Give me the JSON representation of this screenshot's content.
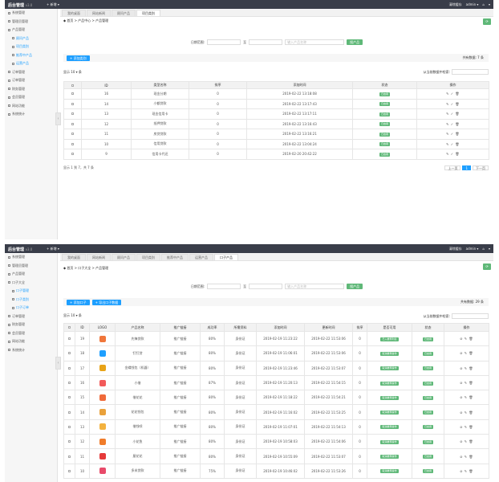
{
  "app": {
    "brand": "后台管理",
    "version": "v3.0",
    "new_menu": "+ 新增 ▾",
    "right_links": [
      "清除缓存",
      "admin ▾"
    ]
  },
  "shot1": {
    "sidebar": [
      {
        "label": "系统管理",
        "sub": false
      },
      {
        "label": "管理员管理",
        "sub": false
      },
      {
        "label": "产品管理",
        "sub": false
      },
      {
        "label": "顾问产品",
        "sub": true
      },
      {
        "label": "项目类别",
        "sub": true
      },
      {
        "label": "推荐中产品",
        "sub": true
      },
      {
        "label": "运营产品",
        "sub": true
      },
      {
        "label": "订单管理",
        "sub": false
      },
      {
        "label": "订单管理",
        "sub": false
      },
      {
        "label": "财务管理",
        "sub": false
      },
      {
        "label": "会员管理",
        "sub": false
      },
      {
        "label": "网站功能",
        "sub": false
      },
      {
        "label": "系统统计",
        "sub": false
      }
    ],
    "tabs": [
      "我的桌面",
      "网站新闻",
      "顾问产品",
      "项目类别"
    ],
    "breadcrumb": "◆ 首页 > 产品中心 > 产品管理",
    "filter": {
      "label": "日期范围:",
      "start": "",
      "sep": "至",
      "keyword_placeholder": "输入产品名称",
      "search_btn": "搜产品"
    },
    "add_btn": "+ 添加类别",
    "total": "共有数据: 7 条",
    "page_size": "显示 10 ▾ 条",
    "search_label": "从当前数据中检索:",
    "columns": [
      "",
      "ID",
      "类型名称",
      "排序",
      "添加时间",
      "状态",
      "操作"
    ],
    "rows": [
      {
        "id": "16",
        "name": "现金分期",
        "sort": "0",
        "time": "2019-02-22 13:18:08",
        "status": "已启用",
        "acts": "✎ ✓ 🗑"
      },
      {
        "id": "14",
        "name": "小额贷款",
        "sort": "0",
        "time": "2019-02-22 13:17:43",
        "status": "已启用",
        "acts": "✎ ✓ 🗑"
      },
      {
        "id": "13",
        "name": "现金信用卡",
        "sort": "0",
        "time": "2019-02-22 13:17:11",
        "status": "已启用",
        "acts": "✎ ✓ 🗑"
      },
      {
        "id": "12",
        "name": "抵押贷款",
        "sort": "0",
        "time": "2019-02-22 13:16:43",
        "status": "已启用",
        "acts": "✎ ✓ 🗑"
      },
      {
        "id": "11",
        "name": "房贷贷款",
        "sort": "0",
        "time": "2019-02-22 13:16:21",
        "status": "已启用",
        "acts": "✎ ✓ 🗑"
      },
      {
        "id": "10",
        "name": "信用贷款",
        "sort": "0",
        "time": "2019-02-22 13:04:24",
        "status": "已启用",
        "acts": "✎ ✓ 🗑"
      },
      {
        "id": "9",
        "name": "信用卡代还",
        "sort": "0",
        "time": "2019-02-20 20:42:22",
        "status": "已启用",
        "acts": "✎ ✓ 🗑"
      }
    ],
    "info": "显示 1 到 7，共 7 条",
    "pagination": [
      "上一页",
      "1",
      "下一页"
    ]
  },
  "shot2": {
    "sidebar": [
      {
        "label": "系统管理",
        "sub": false
      },
      {
        "label": "管理员管理",
        "sub": false
      },
      {
        "label": "产品管理",
        "sub": false
      },
      {
        "label": "口子大全",
        "sub": false
      },
      {
        "label": "口子管理",
        "sub": true
      },
      {
        "label": "口子类别",
        "sub": true
      },
      {
        "label": "口子订单",
        "sub": true
      },
      {
        "label": "订单管理",
        "sub": false
      },
      {
        "label": "财务管理",
        "sub": false
      },
      {
        "label": "会员管理",
        "sub": false
      },
      {
        "label": "网站功能",
        "sub": false
      },
      {
        "label": "系统统计",
        "sub": false
      }
    ],
    "tabs": [
      "我的桌面",
      "网站新闻",
      "顾问产品",
      "项目类别",
      "推荐中产品",
      "运营产品",
      "口子产品"
    ],
    "breadcrumb": "◆ 首页 > 口子大全 > 产品管理",
    "filter": {
      "label": "日期范围:",
      "start": "",
      "sep": "至",
      "keyword_placeholder": "输入产品名称",
      "search_btn": "搜产品"
    },
    "add_btn": "+ 添加口子",
    "add_btn2": "+ 导出口子数据",
    "total": "共有数据: 29 条",
    "page_size": "显示 10 ▾ 条",
    "search_label": "从当前数据中检索:",
    "columns": [
      "",
      "ID",
      "LOGO",
      "产品名称",
      "推广链接",
      "成功率",
      "所需资料",
      "添加时间",
      "更新时间",
      "排序",
      "是否可用",
      "状态",
      "操作"
    ],
    "rows": [
      {
        "id": "19",
        "name": "先锋贷款",
        "link": "推广链接",
        "rate": "80%",
        "req": "身份证",
        "add": "2019-02-19 11:23:22",
        "upd": "2019-02-22 11:53:06",
        "sort": "0",
        "avail": "已入推荐列表",
        "status": "已启用",
        "color": "#f0763a"
      },
      {
        "id": "18",
        "name": "钉钉贷",
        "link": "推广链接",
        "rate": "80%",
        "req": "身份证",
        "add": "2019-02-19 11:06:01",
        "upd": "2019-02-22 11:53:06",
        "sort": "0",
        "avail": "取消推荐操作",
        "status": "已启用",
        "color": "#1e9fff"
      },
      {
        "id": "17",
        "name": "金蝶钱包（机器）",
        "link": "推广链接",
        "rate": "80%",
        "req": "身份证",
        "add": "2019-02-19 11:23:46",
        "upd": "2019-02-22 11:53:07",
        "sort": "0",
        "avail": "取消推荐操作",
        "status": "已启用",
        "color": "#e8a317"
      },
      {
        "id": "16",
        "name": "小借",
        "link": "推广链接",
        "rate": "87%",
        "req": "身份证",
        "add": "2019-02-19 11:20:13",
        "upd": "2019-02-22 11:54:15",
        "sort": "0",
        "avail": "取消推荐操作",
        "status": "已启用",
        "color": "#f25a5a"
      },
      {
        "id": "15",
        "name": "借花花",
        "link": "推广链接",
        "rate": "80%",
        "req": "身份证",
        "add": "2019-02-19 11:18:22",
        "upd": "2019-02-22 11:54:21",
        "sort": "0",
        "avail": "取消推荐操作",
        "status": "已启用",
        "color": "#f06a3a"
      },
      {
        "id": "14",
        "name": "花花钱包",
        "link": "推广链接",
        "rate": "80%",
        "req": "身份证",
        "add": "2019-02-19 11:16:02",
        "upd": "2019-02-22 11:53:25",
        "sort": "0",
        "avail": "取消推荐操作",
        "status": "已启用",
        "color": "#e9a13b"
      },
      {
        "id": "13",
        "name": "借钱呗",
        "link": "推广链接",
        "rate": "80%",
        "req": "身份证",
        "add": "2019-02-19 11:07:01",
        "upd": "2019-02-22 11:54:13",
        "sort": "0",
        "avail": "取消推荐操作",
        "status": "已启用",
        "color": "#f3b23f"
      },
      {
        "id": "12",
        "name": "小花鱼",
        "link": "推广链接",
        "rate": "80%",
        "req": "身份证",
        "add": "2019-02-19 10:58:03",
        "upd": "2019-02-22 11:54:06",
        "sort": "0",
        "avail": "取消推荐操作",
        "status": "已启用",
        "color": "#f07c2a"
      },
      {
        "id": "11",
        "name": "屋花花",
        "link": "推广链接",
        "rate": "80%",
        "req": "身份证",
        "add": "2019-02-19 10:55:09",
        "upd": "2019-02-22 11:53:07",
        "sort": "0",
        "avail": "取消推荐操作",
        "status": "已启用",
        "color": "#e53a3a"
      },
      {
        "id": "10",
        "name": "多米贷款",
        "link": "推广链接",
        "rate": "75%",
        "req": "身份证",
        "add": "2019-02-19 10:46:02",
        "upd": "2019-02-22 11:53:26",
        "sort": "0",
        "avail": "取消推荐操作",
        "status": "已启用",
        "color": "#e84a6a"
      }
    ]
  }
}
